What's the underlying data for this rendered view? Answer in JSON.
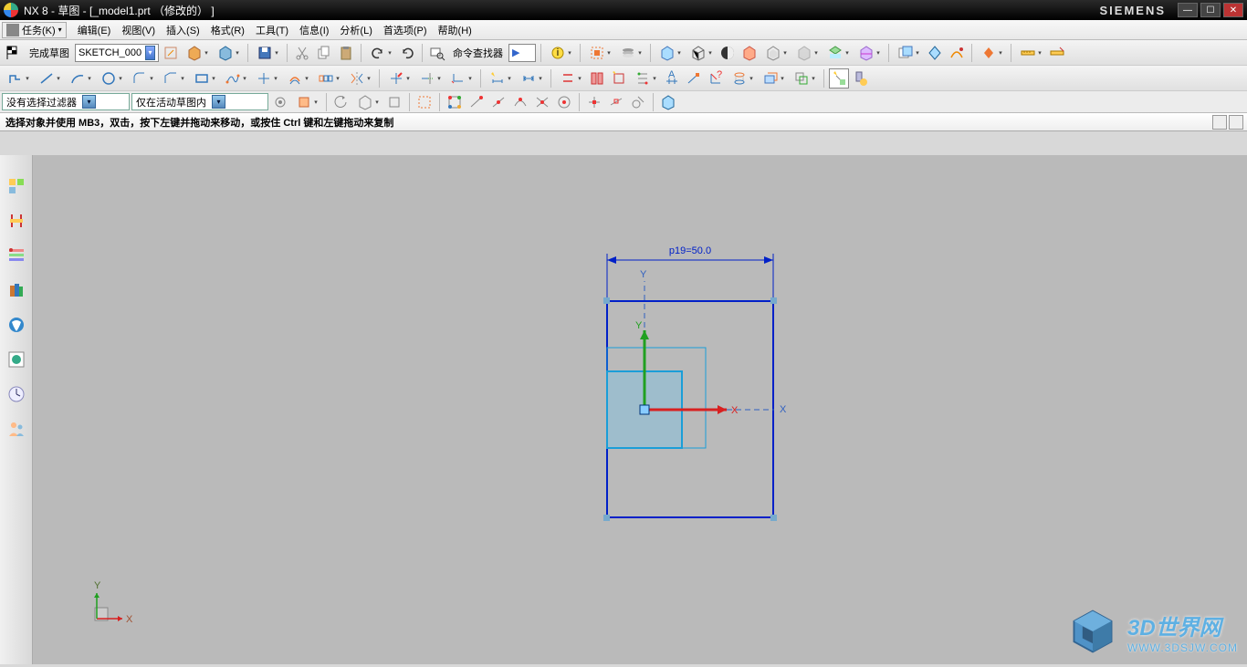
{
  "title_bar": {
    "app": "NX 8 - 草图 - [_model1.prt （修改的） ]",
    "brand": "SIEMENS"
  },
  "menu": {
    "task_label": "任务(K)",
    "items": [
      "编辑(E)",
      "视图(V)",
      "插入(S)",
      "格式(R)",
      "工具(T)",
      "信息(I)",
      "分析(L)",
      "首选项(P)",
      "帮助(H)"
    ]
  },
  "toolbar1": {
    "finish_sketch": "完成草图",
    "sketch_name": "SKETCH_000",
    "command_finder": "命令查找器"
  },
  "filter": {
    "sel_filter": "没有选择过滤器",
    "scope": "仅在活动草图内"
  },
  "prompt": "选择对象并使用 MB3，双击，按下左键并拖动来移动，或按住 Ctrl 键和左键拖动来复制",
  "sketch": {
    "dim_label": "p19=50.0",
    "axis_x": "X",
    "axis_y": "Y"
  },
  "watermark": {
    "name": "3D世界网",
    "url": "WWW.3DSJW.COM"
  },
  "colors": {
    "sketch_blue": "#0020c8",
    "cyan": "#1a9ed8",
    "triad_x": "#d82020",
    "triad_y": "#20a020"
  }
}
